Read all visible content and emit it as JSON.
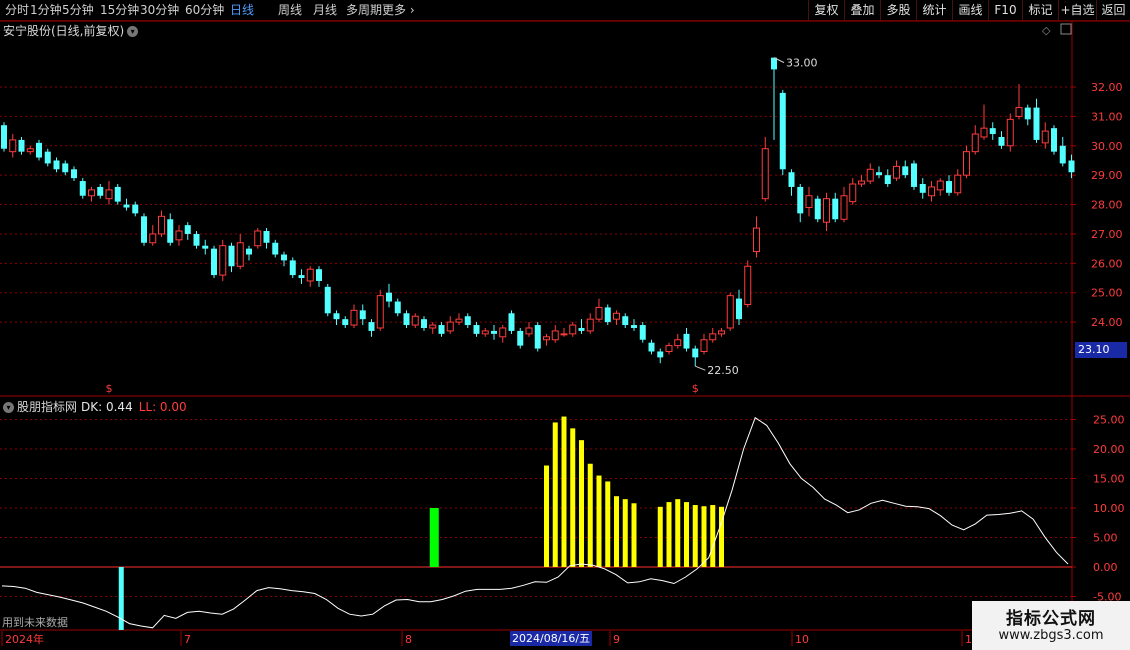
{
  "toolbar": {
    "left_items": [
      "分时",
      "1分钟",
      "5分钟",
      "15分钟",
      "30分钟",
      "60分钟",
      "日线",
      "周线",
      "月线",
      "多周期",
      "更多"
    ],
    "active_item": "日线",
    "right_items": [
      "复权",
      "叠加",
      "多股",
      "统计",
      "画线",
      "F10",
      "标记",
      "+自选",
      "返回"
    ]
  },
  "main_chart": {
    "title": "安宁股份(日线,前复权)",
    "yaxis_labels": [
      "32.00",
      "31.00",
      "30.00",
      "29.00",
      "28.00",
      "27.00",
      "26.00",
      "25.00",
      "24.00"
    ],
    "high_label": "33.00",
    "low_label": "22.50",
    "current_price": "23.10",
    "marker_symbol": "$"
  },
  "indicator": {
    "name": "股朋指标网",
    "dk_text": "DK: 0.44",
    "ll_text": "LL: 0.00",
    "yaxis_labels": [
      "25.00",
      "20.00",
      "15.00",
      "10.00",
      "5.00",
      "0.00",
      "-5.00"
    ],
    "future_note": "用到未来数据"
  },
  "date_axis": {
    "labels": [
      "2024年",
      "7",
      "8",
      "9",
      "10",
      "1"
    ],
    "current_date": "2024/08/16/五"
  },
  "watermark": {
    "title": "指标公式网",
    "url": "www.zbgs3.com"
  },
  "colors": {
    "up": "#ff3c3c",
    "down": "#54ffff",
    "yellow_bar": "#ffff00",
    "green_bar": "#00ff00",
    "grid": "#8b0000",
    "line": "#ffffff"
  },
  "chart_data": {
    "type": "candlestick",
    "y_range": [
      22.2,
      33.6
    ],
    "candles": [
      [
        30.7,
        29.9,
        30.8,
        29.8
      ],
      [
        29.8,
        30.2,
        30.4,
        29.6
      ],
      [
        30.2,
        29.8,
        30.3,
        29.7
      ],
      [
        29.8,
        29.9,
        30.0,
        29.7
      ],
      [
        30.1,
        29.6,
        30.2,
        29.5
      ],
      [
        29.8,
        29.4,
        29.9,
        29.3
      ],
      [
        29.5,
        29.2,
        29.6,
        29.1
      ],
      [
        29.4,
        29.1,
        29.5,
        29.0
      ],
      [
        29.2,
        28.9,
        29.3,
        28.8
      ],
      [
        28.8,
        28.3,
        28.9,
        28.2
      ],
      [
        28.3,
        28.5,
        28.6,
        28.1
      ],
      [
        28.6,
        28.3,
        28.7,
        28.2
      ],
      [
        28.2,
        28.5,
        28.8,
        28.0
      ],
      [
        28.6,
        28.1,
        28.7,
        28.0
      ],
      [
        28.0,
        27.9,
        28.2,
        27.8
      ],
      [
        28.0,
        27.7,
        28.1,
        27.6
      ],
      [
        27.6,
        26.7,
        27.7,
        26.6
      ],
      [
        26.7,
        27.0,
        27.3,
        26.6
      ],
      [
        27.0,
        27.6,
        27.8,
        26.9
      ],
      [
        27.5,
        26.7,
        27.7,
        26.6
      ],
      [
        26.8,
        27.1,
        27.3,
        26.6
      ],
      [
        27.3,
        27.0,
        27.4,
        26.8
      ],
      [
        27.0,
        26.6,
        27.1,
        26.5
      ],
      [
        26.6,
        26.5,
        26.8,
        26.3
      ],
      [
        26.5,
        25.6,
        26.6,
        25.5
      ],
      [
        25.6,
        26.6,
        26.8,
        25.4
      ],
      [
        26.6,
        25.9,
        26.7,
        25.7
      ],
      [
        25.9,
        26.7,
        27.0,
        25.8
      ],
      [
        26.5,
        26.3,
        26.6,
        26.1
      ],
      [
        26.6,
        27.1,
        27.2,
        26.5
      ],
      [
        27.1,
        26.7,
        27.2,
        26.5
      ],
      [
        26.7,
        26.3,
        26.8,
        26.2
      ],
      [
        26.3,
        26.1,
        26.4,
        25.9
      ],
      [
        26.1,
        25.6,
        26.2,
        25.5
      ],
      [
        25.6,
        25.5,
        25.8,
        25.3
      ],
      [
        25.4,
        25.8,
        25.9,
        25.2
      ],
      [
        25.8,
        25.4,
        25.9,
        25.2
      ],
      [
        25.2,
        24.3,
        25.3,
        24.2
      ],
      [
        24.3,
        24.1,
        24.4,
        23.9
      ],
      [
        24.1,
        23.9,
        24.2,
        23.8
      ],
      [
        23.9,
        24.4,
        24.6,
        23.8
      ],
      [
        24.4,
        24.1,
        24.6,
        23.9
      ],
      [
        24.0,
        23.7,
        24.1,
        23.5
      ],
      [
        23.8,
        24.9,
        25.1,
        23.7
      ],
      [
        25.0,
        24.7,
        25.3,
        24.5
      ],
      [
        24.7,
        24.3,
        24.8,
        24.2
      ],
      [
        24.3,
        23.9,
        24.4,
        23.8
      ],
      [
        23.9,
        24.2,
        24.3,
        23.8
      ],
      [
        24.1,
        23.8,
        24.2,
        23.7
      ],
      [
        23.8,
        23.9,
        24.0,
        23.6
      ],
      [
        23.9,
        23.6,
        24.0,
        23.5
      ],
      [
        23.7,
        24.0,
        24.2,
        23.6
      ],
      [
        24.0,
        24.1,
        24.3,
        23.9
      ],
      [
        24.2,
        23.9,
        24.3,
        23.8
      ],
      [
        23.9,
        23.6,
        24.0,
        23.5
      ],
      [
        23.6,
        23.7,
        23.8,
        23.5
      ],
      [
        23.7,
        23.6,
        23.9,
        23.4
      ],
      [
        23.5,
        23.8,
        23.9,
        23.3
      ],
      [
        24.3,
        23.7,
        24.4,
        23.6
      ],
      [
        23.7,
        23.2,
        23.8,
        23.1
      ],
      [
        23.6,
        23.8,
        24.0,
        23.5
      ],
      [
        23.9,
        23.1,
        24.0,
        23.0
      ],
      [
        23.4,
        23.5,
        23.6,
        23.2
      ],
      [
        23.4,
        23.7,
        23.9,
        23.3
      ],
      [
        23.6,
        23.6,
        23.8,
        23.5
      ],
      [
        23.6,
        23.9,
        24.0,
        23.5
      ],
      [
        23.8,
        23.7,
        24.1,
        23.6
      ],
      [
        23.7,
        24.1,
        24.3,
        23.6
      ],
      [
        24.1,
        24.5,
        24.8,
        24.0
      ],
      [
        24.5,
        24.0,
        24.6,
        23.9
      ],
      [
        24.1,
        24.3,
        24.4,
        23.9
      ],
      [
        24.2,
        23.9,
        24.3,
        23.8
      ],
      [
        23.9,
        23.8,
        24.1,
        23.7
      ],
      [
        23.9,
        23.4,
        24.0,
        23.3
      ],
      [
        23.3,
        23.0,
        23.4,
        22.9
      ],
      [
        23.0,
        22.8,
        23.1,
        22.6
      ],
      [
        23.0,
        23.2,
        23.3,
        22.9
      ],
      [
        23.2,
        23.4,
        23.6,
        23.1
      ],
      [
        23.6,
        23.1,
        23.8,
        23.0
      ],
      [
        23.1,
        22.8,
        23.2,
        22.5
      ],
      [
        23.0,
        23.4,
        23.6,
        22.9
      ],
      [
        23.4,
        23.6,
        23.8,
        23.3
      ],
      [
        23.6,
        23.7,
        23.8,
        23.5
      ],
      [
        23.8,
        24.9,
        25.0,
        23.7
      ],
      [
        24.8,
        24.1,
        25.1,
        23.9
      ],
      [
        24.6,
        25.9,
        26.1,
        24.5
      ],
      [
        26.4,
        27.2,
        27.6,
        26.2
      ],
      [
        28.2,
        29.9,
        30.3,
        28.1
      ],
      [
        33.0,
        32.6,
        33.0,
        30.2
      ],
      [
        31.8,
        29.2,
        31.9,
        29.0
      ],
      [
        29.1,
        28.6,
        29.2,
        28.3
      ],
      [
        28.6,
        27.7,
        28.7,
        27.4
      ],
      [
        27.9,
        28.3,
        28.6,
        27.6
      ],
      [
        28.2,
        27.5,
        28.3,
        27.4
      ],
      [
        27.4,
        28.2,
        28.4,
        27.1
      ],
      [
        28.2,
        27.5,
        28.4,
        27.4
      ],
      [
        27.5,
        28.3,
        28.6,
        27.4
      ],
      [
        28.1,
        28.7,
        28.9,
        28.0
      ],
      [
        28.7,
        28.8,
        29.0,
        28.6
      ],
      [
        28.8,
        29.2,
        29.4,
        28.7
      ],
      [
        29.1,
        29.0,
        29.3,
        28.9
      ],
      [
        29.0,
        28.7,
        29.2,
        28.6
      ],
      [
        28.9,
        29.3,
        29.5,
        28.8
      ],
      [
        29.3,
        29.0,
        29.5,
        28.9
      ],
      [
        29.4,
        28.6,
        29.5,
        28.5
      ],
      [
        28.7,
        28.4,
        28.9,
        28.2
      ],
      [
        28.3,
        28.6,
        28.8,
        28.1
      ],
      [
        28.5,
        28.8,
        28.9,
        28.3
      ],
      [
        28.8,
        28.4,
        29.0,
        28.3
      ],
      [
        28.4,
        29.0,
        29.2,
        28.3
      ],
      [
        29.0,
        29.8,
        30.0,
        28.9
      ],
      [
        29.8,
        30.4,
        30.7,
        29.7
      ],
      [
        30.3,
        30.6,
        31.4,
        30.2
      ],
      [
        30.6,
        30.4,
        30.8,
        30.2
      ],
      [
        30.3,
        30.0,
        30.5,
        29.9
      ],
      [
        30.0,
        30.9,
        31.1,
        29.8
      ],
      [
        31.0,
        31.3,
        32.1,
        30.9
      ],
      [
        31.3,
        30.9,
        31.4,
        30.7
      ],
      [
        31.3,
        30.2,
        31.6,
        30.1
      ],
      [
        30.1,
        30.5,
        30.8,
        29.9
      ],
      [
        30.6,
        29.8,
        30.7,
        29.7
      ],
      [
        30.0,
        29.4,
        30.3,
        29.3
      ],
      [
        29.5,
        29.1,
        29.7,
        28.9
      ]
    ],
    "indicator_line": [
      -3.2,
      -3.3,
      -3.6,
      -4.3,
      -4.7,
      -5.1,
      -5.6,
      -6.1,
      -6.8,
      -7.5,
      -8.5,
      -9.6,
      -10.0,
      -10.3,
      -8.2,
      -8.7,
      -7.7,
      -7.5,
      -7.8,
      -8.0,
      -7.1,
      -5.6,
      -4.0,
      -3.5,
      -3.7,
      -4.0,
      -4.2,
      -4.5,
      -5.5,
      -7.0,
      -8.0,
      -8.3,
      -8.0,
      -6.6,
      -5.6,
      -5.5,
      -5.9,
      -5.9,
      -5.5,
      -4.9,
      -4.1,
      -3.8,
      -3.8,
      -3.8,
      -3.6,
      -3.1,
      -2.5,
      -2.6,
      -1.7,
      0.2,
      0.5,
      0.3,
      -0.3,
      -1.3,
      -2.7,
      -2.5,
      -2.0,
      -2.3,
      -2.8,
      -1.7,
      -0.3,
      1.6,
      7.0,
      13.0,
      20.0,
      25.3,
      24.0,
      21.0,
      17.5,
      15.0,
      13.5,
      11.5,
      10.5,
      9.2,
      9.7,
      10.8,
      11.3,
      10.8,
      10.3,
      10.2,
      9.9,
      8.7,
      7.1,
      6.3,
      7.3,
      8.8,
      8.9,
      9.1,
      9.5,
      8.1,
      5.1,
      2.5,
      0.5
    ],
    "yellow_bars": [
      [
        62,
        17.2
      ],
      [
        63,
        24.5
      ],
      [
        64,
        25.5
      ],
      [
        65,
        23.5
      ],
      [
        66,
        21.5
      ],
      [
        67,
        17.5
      ],
      [
        68,
        15.5
      ],
      [
        69,
        14.5
      ],
      [
        70,
        12.0
      ],
      [
        71,
        11.5
      ],
      [
        72,
        10.8
      ],
      [
        75,
        10.2
      ],
      [
        76,
        11.0
      ],
      [
        77,
        11.5
      ],
      [
        78,
        11.0
      ],
      [
        79,
        10.5
      ],
      [
        80,
        10.3
      ],
      [
        81,
        10.5
      ],
      [
        82,
        10.2
      ]
    ],
    "green_bar": [
      49,
      10.0
    ],
    "cyan_bar": [
      13,
      -10.0
    ],
    "x_axis": "2024-06 to 2024-10, daily"
  }
}
